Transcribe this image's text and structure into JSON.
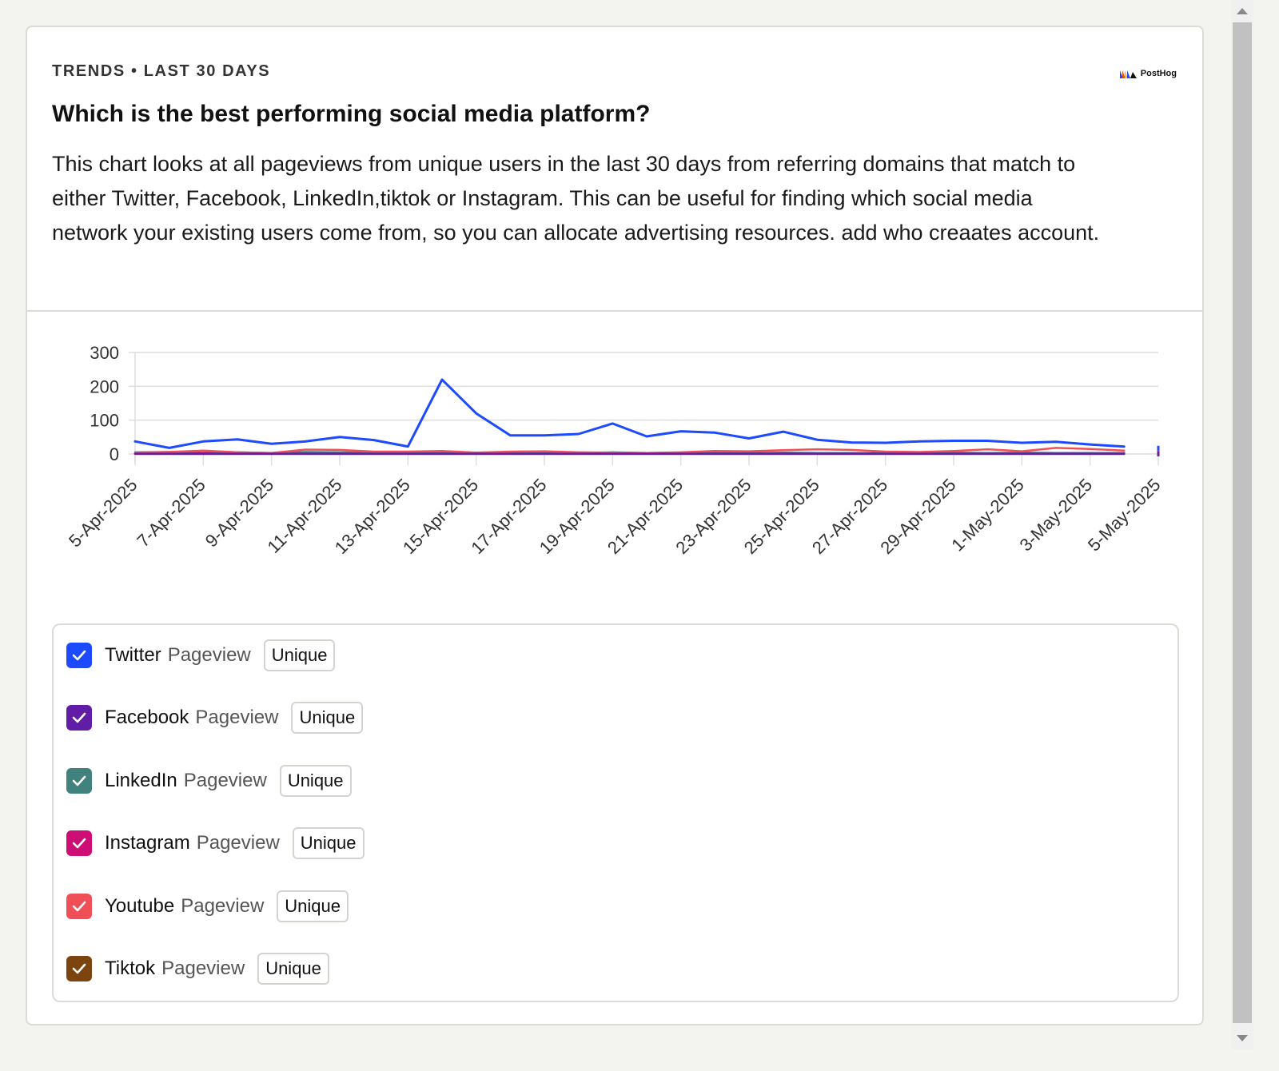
{
  "header": {
    "subtitle": "TRENDS • LAST 30 DAYS",
    "logo_text": "PostHog",
    "title": "Which is the best performing social media platform?",
    "description": "This chart looks at all pageviews from unique users in the last 30 days from referring domains that match to either Twitter, Facebook, LinkedIn,tiktok or Instagram. This can be useful for finding which social media network your existing users come from, so you can allocate advertising resources. add who creaates account."
  },
  "colors": {
    "twitter": "#1d4aff",
    "facebook": "#621da6",
    "linkedin": "#42827e",
    "instagram": "#ce0e74",
    "youtube": "#f14f58",
    "tiktok": "#7c440e"
  },
  "chart_data": {
    "type": "line",
    "x": [
      "5-Apr-2025",
      "6-Apr-2025",
      "7-Apr-2025",
      "8-Apr-2025",
      "9-Apr-2025",
      "10-Apr-2025",
      "11-Apr-2025",
      "12-Apr-2025",
      "13-Apr-2025",
      "14-Apr-2025",
      "15-Apr-2025",
      "16-Apr-2025",
      "17-Apr-2025",
      "18-Apr-2025",
      "19-Apr-2025",
      "20-Apr-2025",
      "21-Apr-2025",
      "22-Apr-2025",
      "23-Apr-2025",
      "24-Apr-2025",
      "25-Apr-2025",
      "26-Apr-2025",
      "27-Apr-2025",
      "28-Apr-2025",
      "29-Apr-2025",
      "30-Apr-2025",
      "1-May-2025",
      "2-May-2025",
      "3-May-2025",
      "4-May-2025",
      "5-May-2025"
    ],
    "x_tick_labels": [
      "5-Apr-2025",
      "7-Apr-2025",
      "9-Apr-2025",
      "11-Apr-2025",
      "13-Apr-2025",
      "15-Apr-2025",
      "17-Apr-2025",
      "19-Apr-2025",
      "21-Apr-2025",
      "23-Apr-2025",
      "25-Apr-2025",
      "27-Apr-2025",
      "29-Apr-2025",
      "1-May-2025",
      "3-May-2025",
      "5-May-2025"
    ],
    "y_ticks": [
      0,
      100,
      200,
      300
    ],
    "ylim": [
      0,
      300
    ],
    "grid": true,
    "series": [
      {
        "name": "Twitter",
        "color_key": "twitter",
        "values": [
          37,
          18,
          37,
          43,
          30,
          37,
          50,
          41,
          22,
          220,
          120,
          55,
          55,
          59,
          90,
          52,
          67,
          63,
          46,
          66,
          42,
          34,
          33,
          37,
          39,
          39,
          33,
          36,
          28,
          22,
          17
        ]
      },
      {
        "name": "Facebook",
        "color_key": "facebook",
        "values": [
          1,
          1,
          1,
          1,
          1,
          1,
          1,
          1,
          1,
          1,
          1,
          1,
          1,
          1,
          1,
          1,
          1,
          1,
          1,
          1,
          1,
          1,
          1,
          1,
          1,
          1,
          1,
          1,
          1,
          1,
          1
        ]
      },
      {
        "name": "LinkedIn",
        "color_key": "linkedin",
        "values": [
          5,
          6,
          8,
          5,
          3,
          6,
          5,
          4,
          5,
          3,
          2,
          4,
          4,
          3,
          5,
          3,
          4,
          4,
          3,
          4,
          3,
          3,
          3,
          4,
          4,
          3,
          4,
          3,
          3,
          3,
          2
        ]
      },
      {
        "name": "Instagram",
        "color_key": "instagram",
        "values": [
          2,
          2,
          2,
          2,
          2,
          2,
          2,
          2,
          2,
          2,
          2,
          2,
          2,
          2,
          2,
          2,
          2,
          2,
          2,
          2,
          2,
          2,
          2,
          2,
          2,
          2,
          2,
          2,
          2,
          2,
          2
        ]
      },
      {
        "name": "Youtube",
        "color_key": "youtube",
        "values": [
          4,
          6,
          10,
          5,
          3,
          13,
          12,
          7,
          7,
          9,
          4,
          7,
          8,
          5,
          4,
          3,
          5,
          9,
          8,
          11,
          14,
          12,
          7,
          6,
          9,
          14,
          8,
          18,
          15,
          10,
          6
        ]
      },
      {
        "name": "Tiktok",
        "color_key": "tiktok",
        "values": [
          0,
          0,
          0,
          0,
          0,
          0,
          0,
          0,
          0,
          0,
          0,
          0,
          0,
          0,
          0,
          0,
          0,
          0,
          0,
          0,
          0,
          0,
          0,
          0,
          0,
          0,
          0,
          0,
          0,
          0,
          0
        ]
      }
    ]
  },
  "legend": {
    "items": [
      {
        "name": "Twitter",
        "event": "Pageview",
        "tag": "Unique",
        "color_key": "twitter"
      },
      {
        "name": "Facebook",
        "event": "Pageview",
        "tag": "Unique",
        "color_key": "facebook"
      },
      {
        "name": "LinkedIn",
        "event": "Pageview",
        "tag": "Unique",
        "color_key": "linkedin"
      },
      {
        "name": "Instagram",
        "event": "Pageview",
        "tag": "Unique",
        "color_key": "instagram"
      },
      {
        "name": "Youtube",
        "event": "Pageview",
        "tag": "Unique",
        "color_key": "youtube"
      },
      {
        "name": "Tiktok",
        "event": "Pageview",
        "tag": "Unique",
        "color_key": "tiktok"
      }
    ]
  }
}
